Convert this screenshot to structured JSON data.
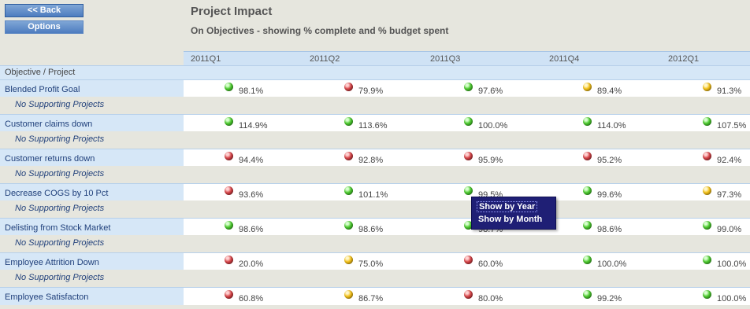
{
  "buttons": {
    "back": "<< Back",
    "options": "Options"
  },
  "header": {
    "title": "Project Impact",
    "subtitle": "On Objectives - showing % complete and % budget spent"
  },
  "quarters": [
    "2011Q1",
    "2011Q2",
    "2011Q3",
    "2011Q4",
    "2012Q1"
  ],
  "column_header": "Objective / Project",
  "rows": [
    {
      "objective": "Blended Profit Goal",
      "sub": "No Supporting Projects",
      "cells": [
        {
          "status": "green",
          "value": "98.1%"
        },
        {
          "status": "red",
          "value": "79.9%"
        },
        {
          "status": "green",
          "value": "97.6%"
        },
        {
          "status": "yellow",
          "value": "89.4%"
        },
        {
          "status": "yellow",
          "value": "91.3%"
        }
      ]
    },
    {
      "objective": "Customer claims down",
      "sub": "No Supporting Projects",
      "cells": [
        {
          "status": "green",
          "value": "114.9%"
        },
        {
          "status": "green",
          "value": "113.6%"
        },
        {
          "status": "green",
          "value": "100.0%"
        },
        {
          "status": "green",
          "value": "114.0%"
        },
        {
          "status": "green",
          "value": "107.5%"
        }
      ]
    },
    {
      "objective": "Customer returns down",
      "sub": "No Supporting Projects",
      "cells": [
        {
          "status": "red",
          "value": "94.4%"
        },
        {
          "status": "red",
          "value": "92.8%"
        },
        {
          "status": "red",
          "value": "95.9%"
        },
        {
          "status": "red",
          "value": "95.2%"
        },
        {
          "status": "red",
          "value": "92.4%"
        }
      ]
    },
    {
      "objective": "Decrease COGS by 10 Pct",
      "sub": "No Supporting Projects",
      "cells": [
        {
          "status": "red",
          "value": "93.6%"
        },
        {
          "status": "green",
          "value": "101.1%"
        },
        {
          "status": "green",
          "value": "99.5%"
        },
        {
          "status": "green",
          "value": "99.6%"
        },
        {
          "status": "yellow",
          "value": "97.3%"
        }
      ]
    },
    {
      "objective": "Delisting from Stock Market",
      "sub": "No Supporting Projects",
      "cells": [
        {
          "status": "green",
          "value": "98.6%"
        },
        {
          "status": "green",
          "value": "98.6%"
        },
        {
          "status": "green",
          "value": "98.7%"
        },
        {
          "status": "green",
          "value": "98.6%"
        },
        {
          "status": "green",
          "value": "99.0%"
        }
      ]
    },
    {
      "objective": "Employee Attrition Down",
      "sub": "No Supporting Projects",
      "cells": [
        {
          "status": "red",
          "value": "20.0%"
        },
        {
          "status": "yellow",
          "value": "75.0%"
        },
        {
          "status": "red",
          "value": "60.0%"
        },
        {
          "status": "green",
          "value": "100.0%"
        },
        {
          "status": "green",
          "value": "100.0%"
        }
      ]
    },
    {
      "objective": "Employee Satisfacton",
      "sub": "",
      "cells": [
        {
          "status": "red",
          "value": "60.8%"
        },
        {
          "status": "yellow",
          "value": "86.7%"
        },
        {
          "status": "red",
          "value": "80.0%"
        },
        {
          "status": "green",
          "value": "99.2%"
        },
        {
          "status": "green",
          "value": "100.0%"
        }
      ]
    }
  ],
  "context_menu": {
    "items": [
      "Show by Year",
      "Show by Month"
    ]
  },
  "colors": {
    "green": "#4ecb30",
    "red": "#d8464a",
    "yellow": "#f4c21a",
    "header_blue": "#d6e7f7"
  },
  "icons": {
    "status": "status-dot-icon"
  }
}
